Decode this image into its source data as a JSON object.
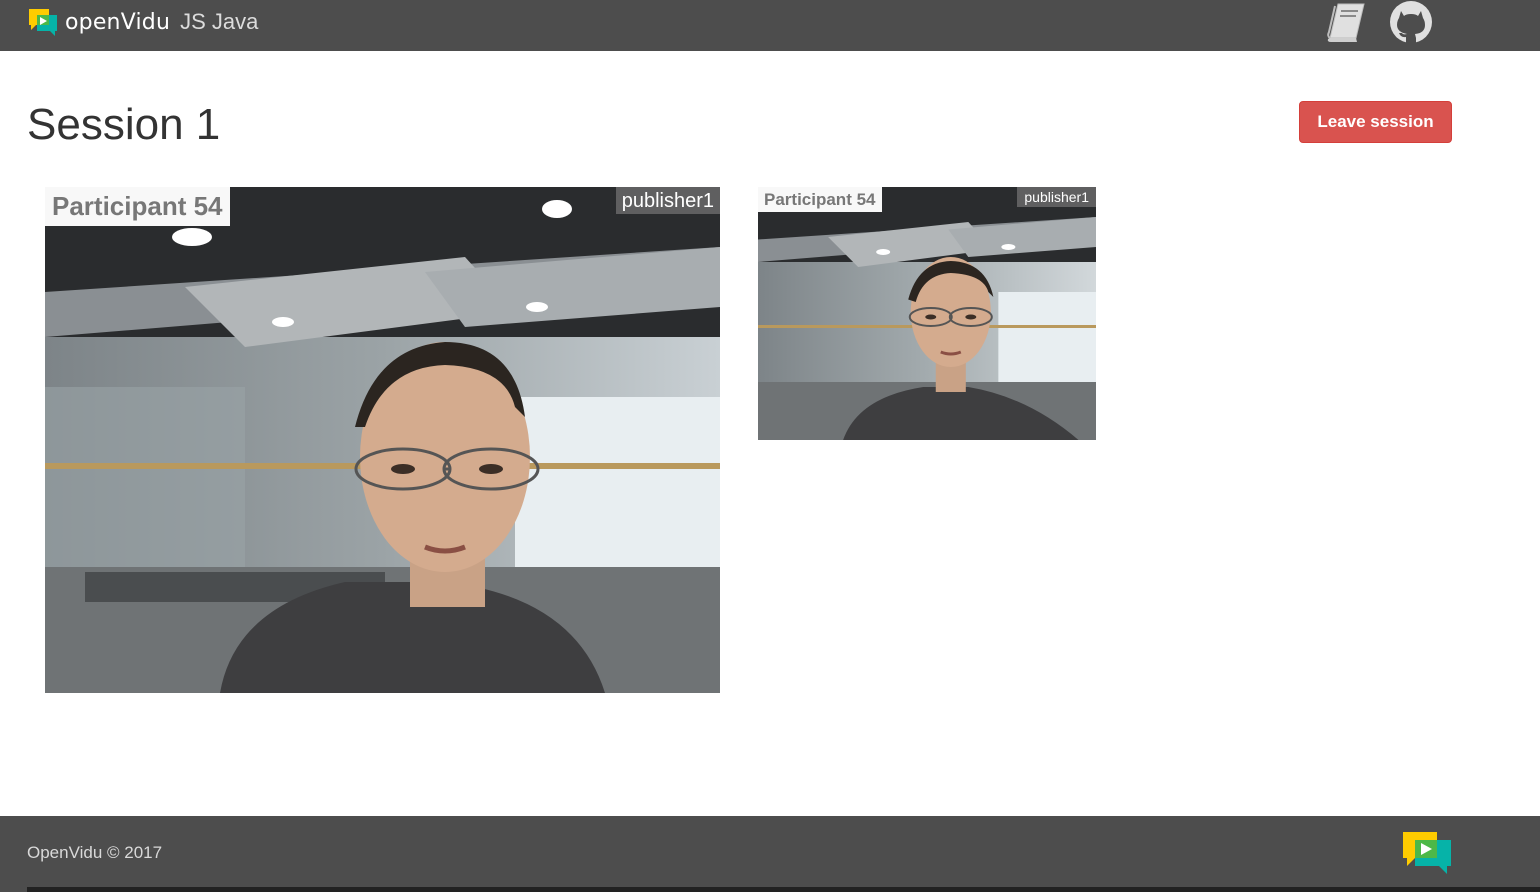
{
  "header": {
    "brand_name": "openVidu",
    "brand_sub": "JS Java",
    "icons": [
      "book-icon",
      "github-icon"
    ]
  },
  "main": {
    "session_title": "Session 1",
    "leave_button": "Leave session",
    "videos": [
      {
        "participant": "Participant 54",
        "stream": "publisher1"
      },
      {
        "participant": "Participant 54",
        "stream": "publisher1"
      }
    ]
  },
  "footer": {
    "copyright": "OpenVidu © 2017"
  },
  "colors": {
    "navbar": "#4d4d4d",
    "danger": "#d9534f",
    "logo_yellow": "#ffcc00",
    "logo_teal": "#06b3a8",
    "logo_green": "#4db848"
  }
}
